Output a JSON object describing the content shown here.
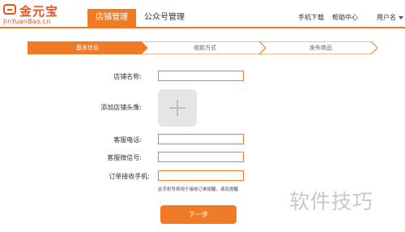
{
  "logo": {
    "name": "金元宝",
    "sub": "JinYuanBao.cn"
  },
  "nav": {
    "active": "店铺管理",
    "tab": "公众号管理",
    "mobile_download": "手机下载",
    "help": "帮助中心",
    "username": "用户名"
  },
  "steps": [
    "基本信息",
    "收款方式",
    "发布商品"
  ],
  "form": {
    "shop_name": "店铺名称:",
    "avatar": "添加店铺头像:",
    "service_phone": "客服电话:",
    "service_wechat": "客服微信号:",
    "order_phone": "订单接收手机:",
    "hint": "此手机号将用于接收订单提醒，请及提醒"
  },
  "next": "下一步",
  "watermark": "软件技巧",
  "colors": {
    "accent": "#f07a25"
  }
}
